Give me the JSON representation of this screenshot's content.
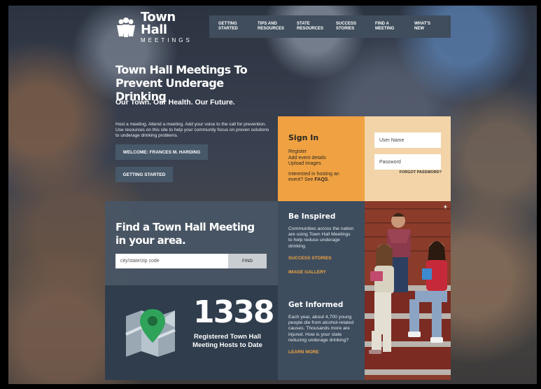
{
  "logo": {
    "title": "Town Hall",
    "subtitle": "MEETINGS"
  },
  "nav": {
    "items": [
      {
        "line1": "GETTING",
        "line2": "STARTED"
      },
      {
        "line1": "TIPS AND",
        "line2": "RESOURCES"
      },
      {
        "line1": "STATE",
        "line2": "RESOURCES"
      },
      {
        "line1": "SUCCESS",
        "line2": "STORIES"
      },
      {
        "line1": "FIND A",
        "line2": "MEETING"
      },
      {
        "line1": "WHAT'S",
        "line2": "NEW"
      }
    ]
  },
  "hero": {
    "title": "Town Hall Meetings To Prevent Underage Drinking",
    "tagline": "Our Town. Our Health. Our Future.",
    "description": "Host a meeting. Attend a meeting. Add your voice to the call for prevention. Use resources on this site to help your community focus on proven solutions to underage drinking problems.",
    "welcome_button": "WELCOME: FRANCES M. HARDING",
    "start_button": "GETTING STARTED"
  },
  "signin": {
    "heading": "Sign In",
    "links": [
      "Register",
      "Add event details",
      "Upload images"
    ],
    "host_text": "Interested in hosting an event? See ",
    "faq_link": "FAQS",
    "host_end": ".",
    "username_placeholder": "User Name",
    "password_placeholder": "Password",
    "forgot_link": "FORGOT PASSWORD?"
  },
  "find": {
    "heading": "Find a Town Hall Meeting in your area.",
    "input_placeholder": "city/state/zip code",
    "button": "FIND"
  },
  "inspired": {
    "heading": "Be Inspired",
    "text": "Communities across the nation are using Town Hall Meetings to help reduce underage drinking.",
    "link1": "SUCCESS STORIES",
    "link2": "IMAGE GALLERY"
  },
  "count": {
    "number": "1338",
    "label": "Registered Town Hall Meeting Hosts to Date"
  },
  "informed": {
    "heading": "Get Informed",
    "text": "Each year, about 4,700 young people die from alcohol-related causes. Thousands more are injured. How is your state reducing underage drinking?",
    "link": "LEARN MORE"
  },
  "photo": {
    "corner_glyph": "+"
  },
  "colors": {
    "accent_orange": "#f0a242",
    "panel_slate": "#3d4d5e",
    "nav_bg": "#3f4d5c",
    "login_peach": "#f2d4a8"
  }
}
